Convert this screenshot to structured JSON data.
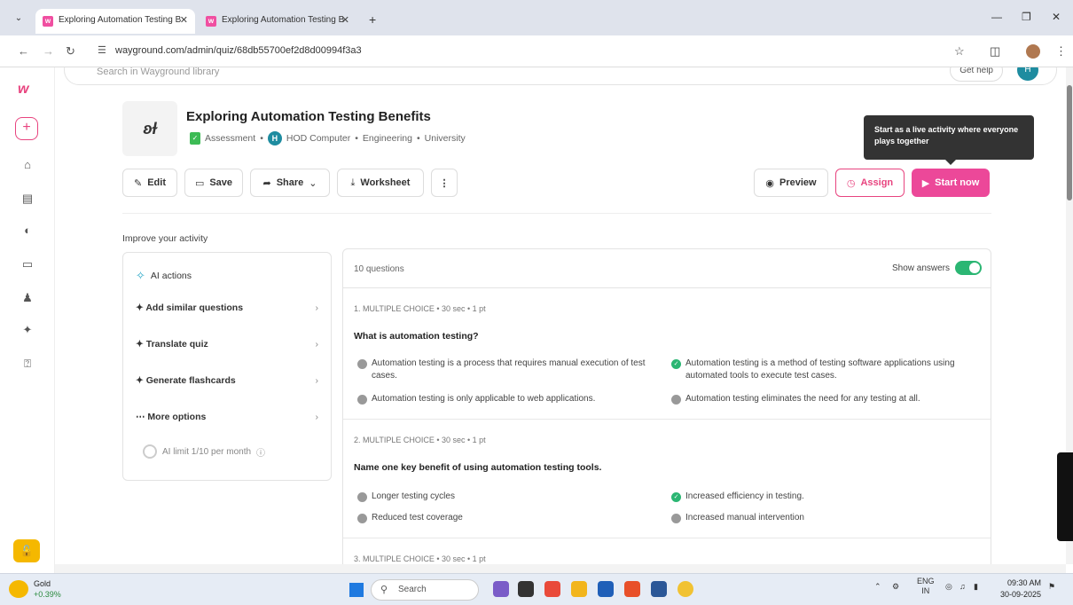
{
  "browser": {
    "tabs": [
      {
        "title": "Exploring Automation Testing B",
        "active": true
      },
      {
        "title": "Exploring Automation Testing B",
        "active": false
      }
    ],
    "url": "wayground.com/admin/quiz/68db55700ef2d8d00994f3a3"
  },
  "header": {
    "search_placeholder": "Search in Wayground library",
    "help_label": "Get help",
    "user_initial": "H"
  },
  "quiz": {
    "thumb": "ʚɫ",
    "title": "Exploring Automation Testing Benefits",
    "type": "Assessment",
    "author_initial": "H",
    "author": "HOD Computer",
    "subject": "Engineering",
    "level": "University"
  },
  "toolbar": {
    "edit": "Edit",
    "save": "Save",
    "share": "Share",
    "worksheet": "Worksheet",
    "preview": "Preview",
    "assign": "Assign",
    "start": "Start now"
  },
  "tooltip": "Start as a live activity where everyone plays together",
  "improve_label": "Improve your activity",
  "ai": {
    "header": "AI actions",
    "items": [
      "Add similar questions",
      "Translate quiz",
      "Generate flashcards",
      "More options"
    ],
    "limit": "AI limit 1/10 per month"
  },
  "questions_panel": {
    "count": "10 questions",
    "show_answers": "Show answers",
    "questions": [
      {
        "meta": "1. MULTIPLE CHOICE • 30 sec • 1 pt",
        "text": "What is automation testing?",
        "options": [
          "Automation testing is a process that requires manual execution of test cases.",
          "Automation testing is a method of testing software applications using automated tools to execute test cases.",
          "Automation testing is only applicable to web applications.",
          "Automation testing eliminates the need for any testing at all."
        ],
        "correct": 1
      },
      {
        "meta": "2. MULTIPLE CHOICE • 30 sec • 1 pt",
        "text": "Name one key benefit of using automation testing tools.",
        "options": [
          "Longer testing cycles",
          "Increased efficiency in testing.",
          "Reduced test coverage",
          "Increased manual intervention"
        ],
        "correct": 1
      },
      {
        "meta": "3. MULTIPLE CHOICE • 30 sec • 1 pt"
      }
    ]
  },
  "taskbar": {
    "weather_label": "Gold",
    "weather_change": "+0.39%",
    "search": "Search",
    "lang": "ENG",
    "region": "IN",
    "time": "09:30 AM",
    "date": "30-09-2025"
  },
  "colors": {
    "brand": "#ec4899",
    "success": "#2bb673",
    "accent": "#1e8ca0"
  }
}
